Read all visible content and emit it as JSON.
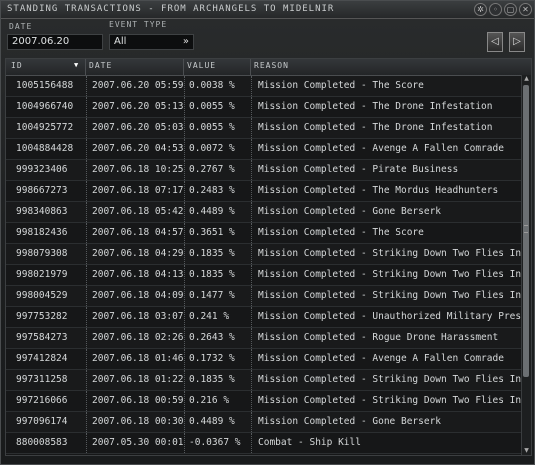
{
  "window": {
    "title": "STANDING TRANSACTIONS - FROM ARCHANGELS TO MIDELNIR"
  },
  "filters": {
    "date_label": "DATE",
    "date_value": "2007.06.20",
    "event_type_label": "EVENT TYPE",
    "event_type_value": "All"
  },
  "table": {
    "columns": [
      "ID",
      "DATE",
      "VALUE",
      "REASON"
    ],
    "rows": [
      {
        "id": "1005156488",
        "date": "2007.06.20 05:59",
        "value": "0.0038 %",
        "reason": "Mission Completed - The Score"
      },
      {
        "id": "1004966740",
        "date": "2007.06.20 05:13",
        "value": "0.0055 %",
        "reason": "Mission Completed - The Drone Infestation"
      },
      {
        "id": "1004925772",
        "date": "2007.06.20 05:03",
        "value": "0.0055 %",
        "reason": "Mission Completed - The Drone Infestation"
      },
      {
        "id": "1004884428",
        "date": "2007.06.20 04:53",
        "value": "0.0072 %",
        "reason": "Mission Completed - Avenge A Fallen Comrade"
      },
      {
        "id": "999323406",
        "date": "2007.06.18 10:25",
        "value": "0.2767 %",
        "reason": "Mission Completed - Pirate Business"
      },
      {
        "id": "998667273",
        "date": "2007.06.18 07:17",
        "value": "0.2483 %",
        "reason": "Mission Completed - The Mordus Headhunters"
      },
      {
        "id": "998340863",
        "date": "2007.06.18 05:42",
        "value": "0.4489 %",
        "reason": "Mission Completed - Gone Berserk"
      },
      {
        "id": "998182436",
        "date": "2007.06.18 04:57",
        "value": "0.3651 %",
        "reason": "Mission Completed - The Score"
      },
      {
        "id": "998079308",
        "date": "2007.06.18 04:29",
        "value": "0.1835 %",
        "reason": "Mission Completed - Striking Down Two Flies In One"
      },
      {
        "id": "998021979",
        "date": "2007.06.18 04:13",
        "value": "0.1835 %",
        "reason": "Mission Completed - Striking Down Two Flies In One"
      },
      {
        "id": "998004529",
        "date": "2007.06.18 04:09",
        "value": "0.1477 %",
        "reason": "Mission Completed - Striking Down Two Flies In One"
      },
      {
        "id": "997753282",
        "date": "2007.06.18 03:07",
        "value": "0.241 %",
        "reason": "Mission Completed - Unauthorized Military Presence"
      },
      {
        "id": "997584273",
        "date": "2007.06.18 02:26",
        "value": "0.2643 %",
        "reason": "Mission Completed - Rogue Drone Harassment"
      },
      {
        "id": "997412824",
        "date": "2007.06.18 01:46",
        "value": "0.1732 %",
        "reason": "Mission Completed - Avenge A Fallen Comrade"
      },
      {
        "id": "997311258",
        "date": "2007.06.18 01:22",
        "value": "0.1835 %",
        "reason": "Mission Completed - Striking Down Two Flies In One"
      },
      {
        "id": "997216066",
        "date": "2007.06.18 00:59",
        "value": "0.216 %",
        "reason": "Mission Completed - Striking Down Two Flies In One"
      },
      {
        "id": "997096174",
        "date": "2007.06.18 00:30",
        "value": "0.4489 %",
        "reason": "Mission Completed - Gone Berserk"
      },
      {
        "id": "880008583",
        "date": "2007.05.30 00:01",
        "value": "-0.0367 %",
        "reason": "Combat - Ship Kill"
      }
    ]
  }
}
